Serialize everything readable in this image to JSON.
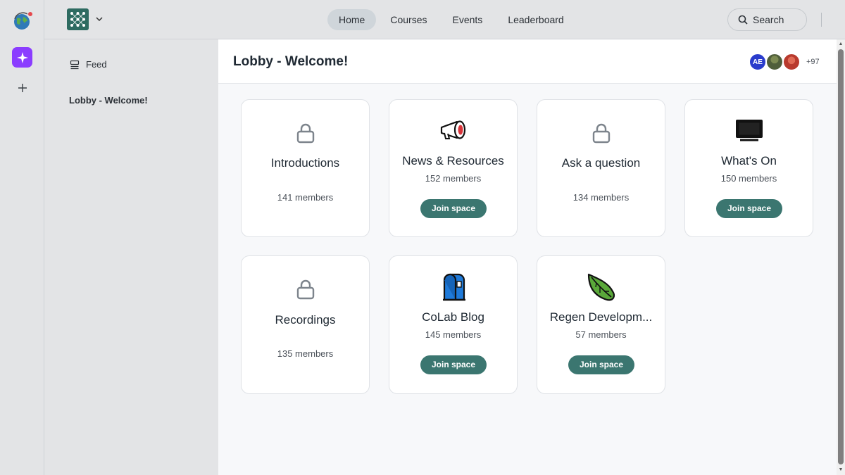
{
  "rail": {
    "icons": [
      "globe-icon",
      "sparkle-icon",
      "plus-icon"
    ],
    "ai_color": "#8b3dff",
    "notification_color": "#e5484d"
  },
  "topbar": {
    "nav": [
      "Home",
      "Courses",
      "Events",
      "Leaderboard"
    ],
    "active_nav": "Home",
    "search_label": "Search"
  },
  "sidebar": {
    "feed_label": "Feed",
    "lobby_label": "Lobby - Welcome!"
  },
  "main": {
    "title": "Lobby - Welcome!",
    "avatars": [
      {
        "initials": "AE",
        "color": "#2a3ccc"
      },
      {
        "initials": "",
        "color": "#5d6b42"
      },
      {
        "initials": "",
        "color": "#c9483a"
      }
    ],
    "avatar_more": "+97",
    "join_label": "Join space",
    "accent": "#3b7670",
    "spaces": [
      {
        "name": "Introductions",
        "members": "141 members",
        "icon": "lock-icon",
        "joinable": false
      },
      {
        "name": "News & Resources",
        "members": "152 members",
        "icon": "megaphone-icon",
        "joinable": true
      },
      {
        "name": "Ask a question",
        "members": "134 members",
        "icon": "lock-icon",
        "joinable": false
      },
      {
        "name": "What's On",
        "members": "150 members",
        "icon": "monitor-icon",
        "joinable": true
      },
      {
        "name": "Recordings",
        "members": "135 members",
        "icon": "lock-icon",
        "joinable": false
      },
      {
        "name": "CoLab Blog",
        "members": "145 members",
        "icon": "mailbox-icon",
        "joinable": true
      },
      {
        "name": "Regen Developm...",
        "members": "57 members",
        "icon": "leaf-icon",
        "joinable": true
      }
    ]
  }
}
